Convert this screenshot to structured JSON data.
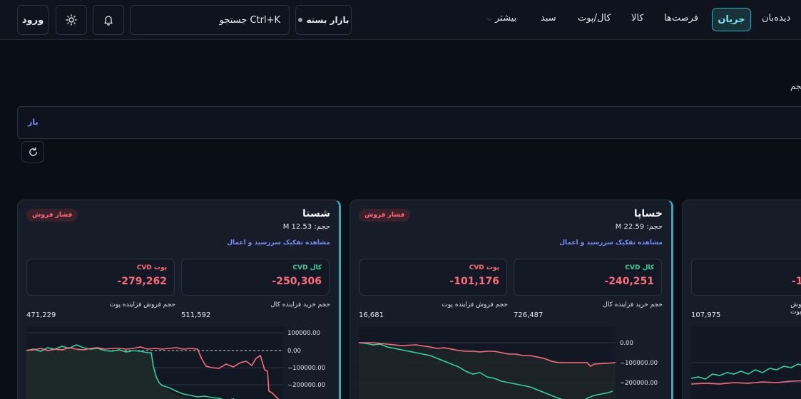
{
  "header": {
    "login_label": "ورود",
    "search_label": "جستجو Ctrl+K",
    "market_status": "بازار بسته",
    "nav": [
      {
        "label": "دیده‌بان"
      },
      {
        "label": "جریان",
        "active": true
      },
      {
        "label": "فرصت‌ها"
      },
      {
        "label": "کالا"
      },
      {
        "label": "کال/پوت"
      },
      {
        "label": "سبد"
      },
      {
        "label": "بیشتر"
      }
    ]
  },
  "page": {
    "note": "حجم.",
    "filter_label": "باز"
  },
  "cards": [
    {
      "symbol": "شستا",
      "badge": "فشار فروش",
      "volume": "حجم: 12.53 M",
      "detail_link": "مشاهده تفکیک سررسید و اعمال",
      "call_cvd_label": "CVD کال",
      "call_cvd": "-250,306",
      "put_cvd_label": "CVD پوت",
      "put_cvd": "-279,262",
      "call_buy_label": "حجم خرید فزاینده کال",
      "call_buy": "511,592",
      "put_sell_label": "حجم فروش فزاینده پوت",
      "put_sell": "471,229",
      "chart_ticks": [
        "100000.00",
        "0.00",
        "−100000.00",
        "−200000.00"
      ]
    },
    {
      "symbol": "خساپا",
      "badge": "فشار فروش",
      "volume": "حجم: 22.59 M",
      "detail_link": "مشاهده تفکیک سررسید و اعمال",
      "call_cvd_label": "CVD کال",
      "call_cvd": "-240,251",
      "put_cvd_label": "CVD پوت",
      "put_cvd": "-101,176",
      "call_buy_label": "حجم خرید فزاینده کال",
      "call_buy": "726,487",
      "put_sell_label": "حجم فروش فزاینده پوت",
      "put_sell": "16,681",
      "chart_ticks": [
        "0.00",
        "−100000.00",
        "−200000.00"
      ]
    },
    {
      "put_cvd_partial": "-1",
      "put_sell_label": "حجم فروش فزاینده پوت",
      "put_sell": "107,975"
    }
  ],
  "colors": {
    "accent": "#22b0c4",
    "call": "#34d399",
    "put": "#ff6b78",
    "link": "#7c8cff"
  },
  "chart_data": [
    {
      "type": "line",
      "series": [],
      "yticks": [
        100000,
        0,
        -100000,
        -200000
      ]
    },
    {
      "type": "line",
      "series": [],
      "yticks": [
        0,
        -100000,
        -200000
      ]
    }
  ]
}
